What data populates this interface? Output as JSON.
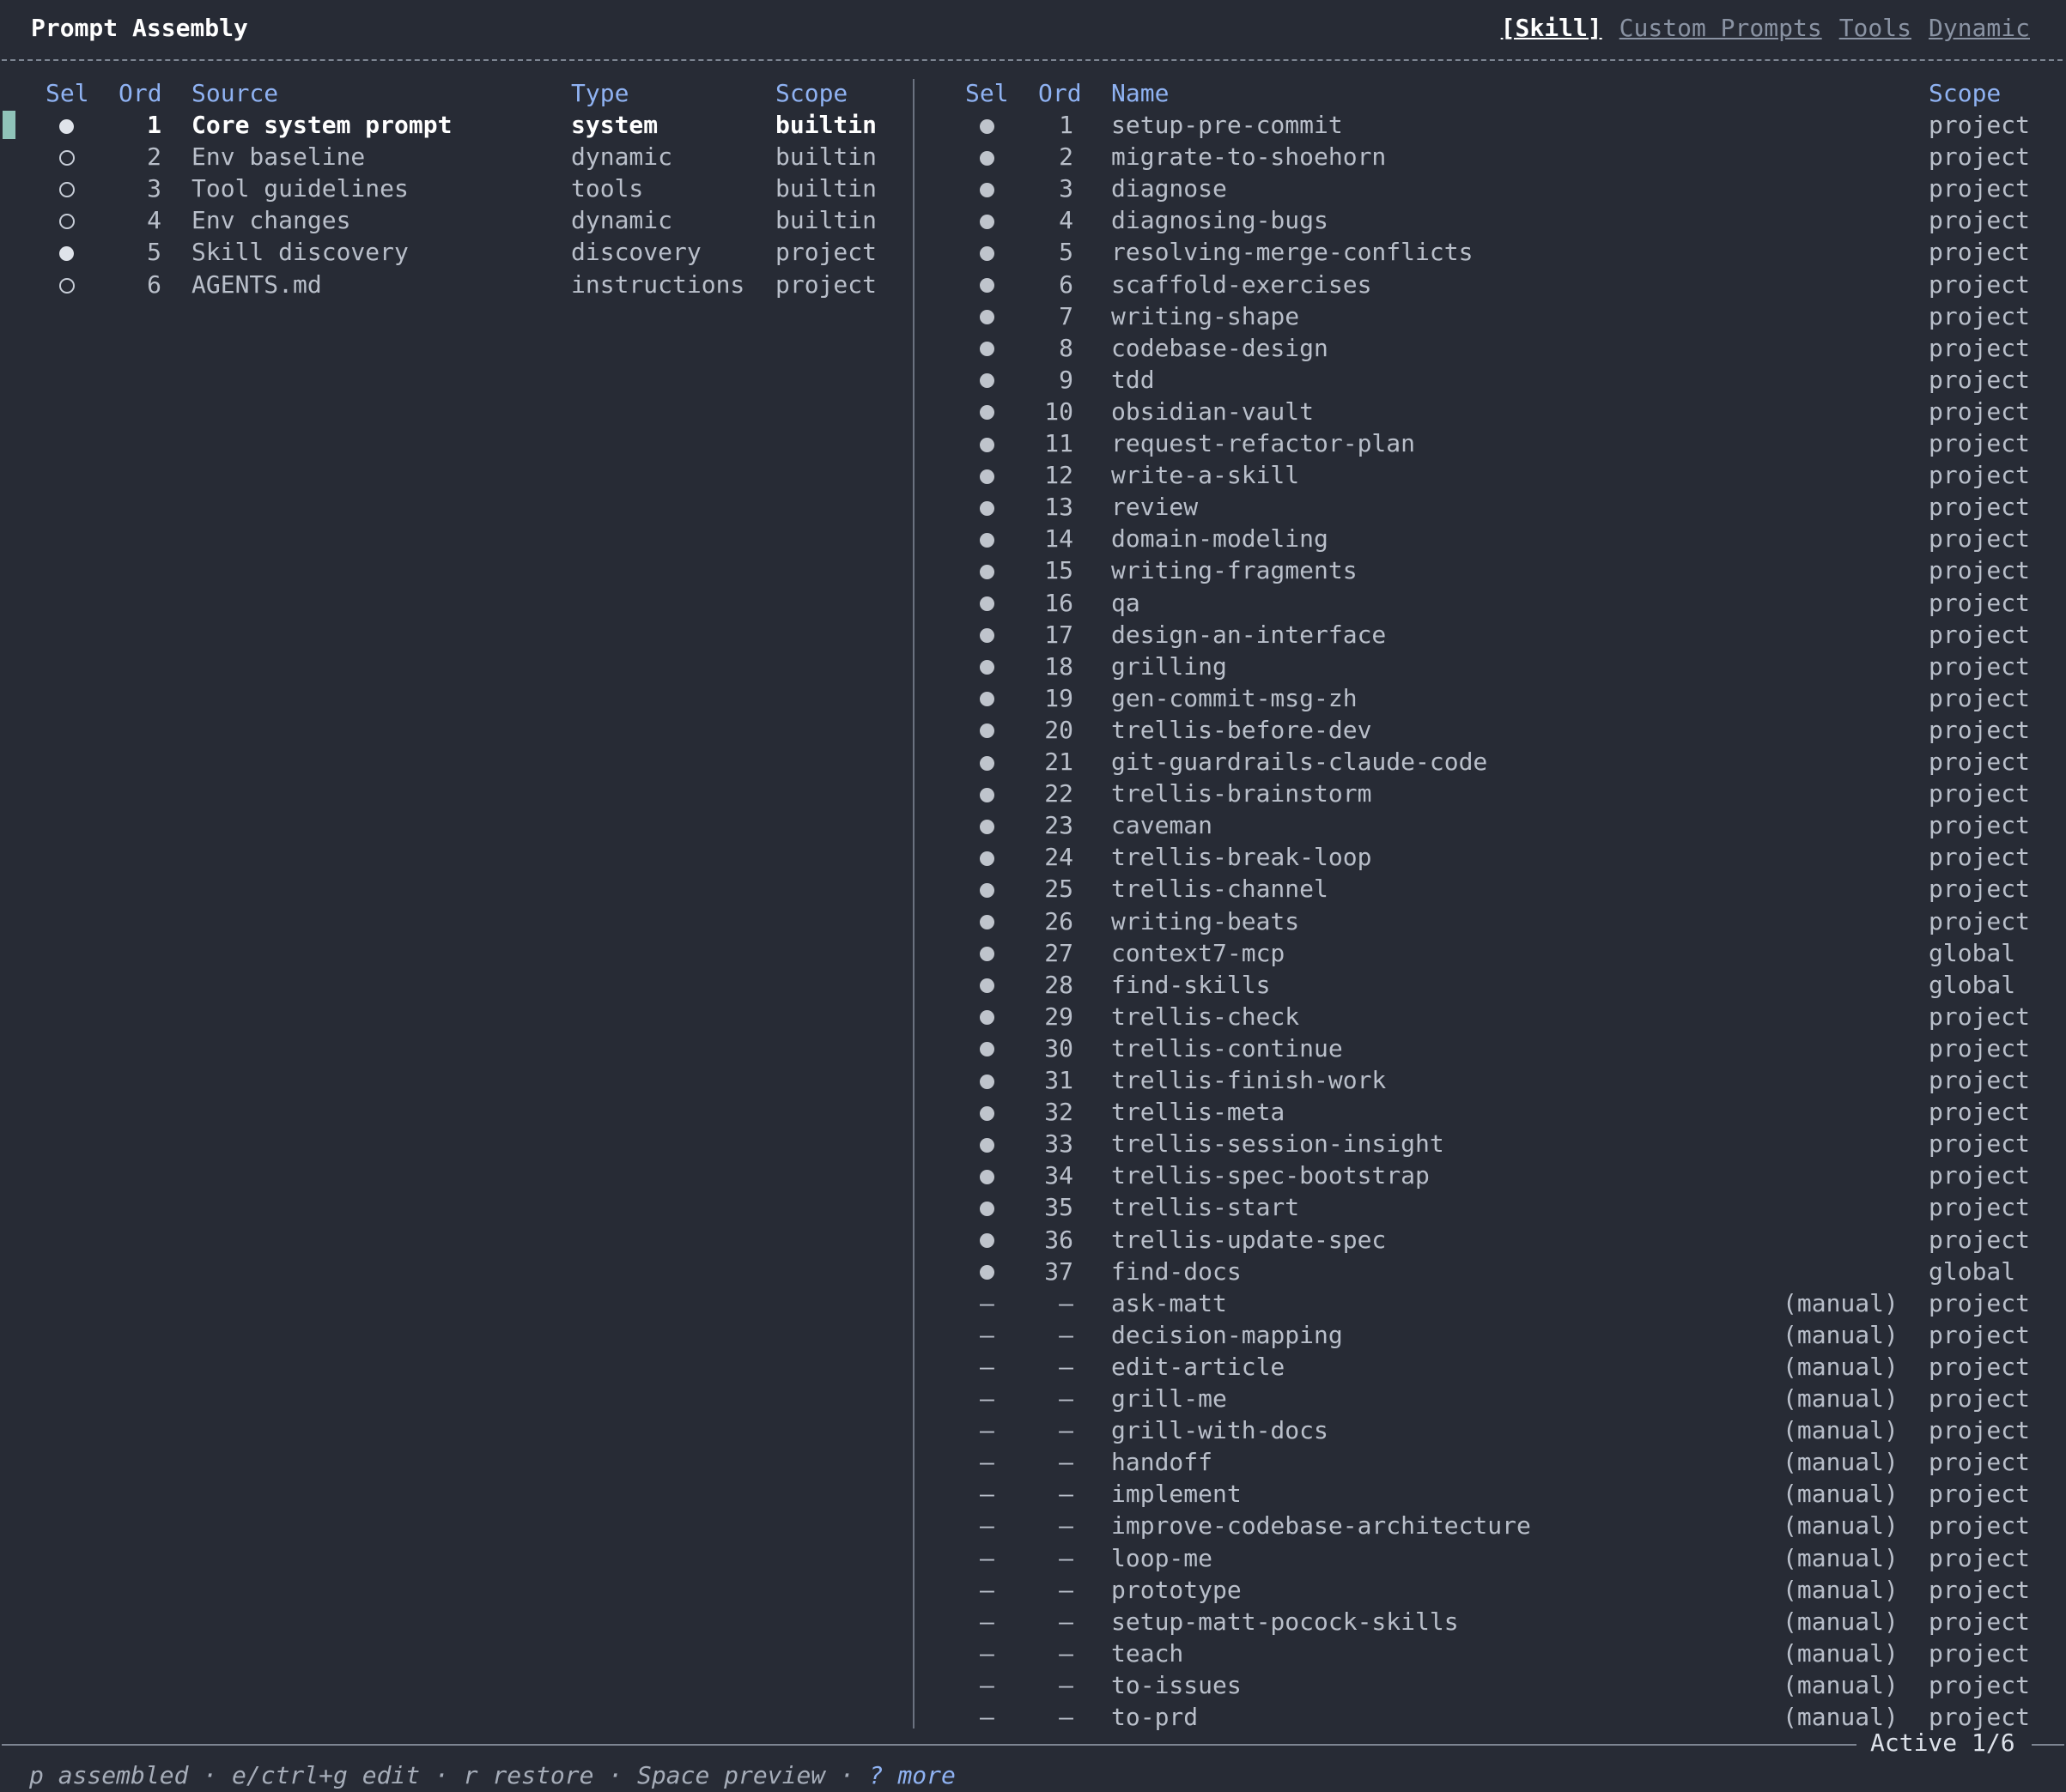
{
  "app": {
    "title": "Prompt Assembly",
    "tabs": [
      "[Skill]",
      "Custom Prompts",
      "Tools",
      "Dynamic"
    ],
    "active_tab": "[Skill]"
  },
  "left_panel": {
    "headers": {
      "sel": "Sel",
      "ord": "Ord",
      "source": "Source",
      "type": "Type",
      "scope": "Scope"
    },
    "rows": [
      {
        "sel": "filled",
        "ord": "1",
        "source": "Core system prompt",
        "type": "system",
        "scope": "builtin",
        "highlight": true
      },
      {
        "sel": "empty",
        "ord": "2",
        "source": "Env baseline",
        "type": "dynamic",
        "scope": "builtin"
      },
      {
        "sel": "empty",
        "ord": "3",
        "source": "Tool guidelines",
        "type": "tools",
        "scope": "builtin"
      },
      {
        "sel": "empty",
        "ord": "4",
        "source": "Env changes",
        "type": "dynamic",
        "scope": "builtin"
      },
      {
        "sel": "filled",
        "ord": "5",
        "source": "Skill discovery",
        "type": "discovery",
        "scope": "project"
      },
      {
        "sel": "empty",
        "ord": "6",
        "source": "AGENTS.md",
        "type": "instructions",
        "scope": "project"
      }
    ]
  },
  "right_panel": {
    "headers": {
      "sel": "Sel",
      "ord": "Ord",
      "name": "Name",
      "scope": "Scope"
    },
    "rows": [
      {
        "sel": "dot",
        "ord": "1",
        "name": "setup-pre-commit",
        "note": "",
        "scope": "project"
      },
      {
        "sel": "dot",
        "ord": "2",
        "name": "migrate-to-shoehorn",
        "note": "",
        "scope": "project"
      },
      {
        "sel": "dot",
        "ord": "3",
        "name": "diagnose",
        "note": "",
        "scope": "project"
      },
      {
        "sel": "dot",
        "ord": "4",
        "name": "diagnosing-bugs",
        "note": "",
        "scope": "project"
      },
      {
        "sel": "dot",
        "ord": "5",
        "name": "resolving-merge-conflicts",
        "note": "",
        "scope": "project"
      },
      {
        "sel": "dot",
        "ord": "6",
        "name": "scaffold-exercises",
        "note": "",
        "scope": "project"
      },
      {
        "sel": "dot",
        "ord": "7",
        "name": "writing-shape",
        "note": "",
        "scope": "project"
      },
      {
        "sel": "dot",
        "ord": "8",
        "name": "codebase-design",
        "note": "",
        "scope": "project"
      },
      {
        "sel": "dot",
        "ord": "9",
        "name": "tdd",
        "note": "",
        "scope": "project"
      },
      {
        "sel": "dot",
        "ord": "10",
        "name": "obsidian-vault",
        "note": "",
        "scope": "project"
      },
      {
        "sel": "dot",
        "ord": "11",
        "name": "request-refactor-plan",
        "note": "",
        "scope": "project"
      },
      {
        "sel": "dot",
        "ord": "12",
        "name": "write-a-skill",
        "note": "",
        "scope": "project"
      },
      {
        "sel": "dot",
        "ord": "13",
        "name": "review",
        "note": "",
        "scope": "project"
      },
      {
        "sel": "dot",
        "ord": "14",
        "name": "domain-modeling",
        "note": "",
        "scope": "project"
      },
      {
        "sel": "dot",
        "ord": "15",
        "name": "writing-fragments",
        "note": "",
        "scope": "project"
      },
      {
        "sel": "dot",
        "ord": "16",
        "name": "qa",
        "note": "",
        "scope": "project"
      },
      {
        "sel": "dot",
        "ord": "17",
        "name": "design-an-interface",
        "note": "",
        "scope": "project"
      },
      {
        "sel": "dot",
        "ord": "18",
        "name": "grilling",
        "note": "",
        "scope": "project"
      },
      {
        "sel": "dot",
        "ord": "19",
        "name": "gen-commit-msg-zh",
        "note": "",
        "scope": "project"
      },
      {
        "sel": "dot",
        "ord": "20",
        "name": "trellis-before-dev",
        "note": "",
        "scope": "project"
      },
      {
        "sel": "dot",
        "ord": "21",
        "name": "git-guardrails-claude-code",
        "note": "",
        "scope": "project"
      },
      {
        "sel": "dot",
        "ord": "22",
        "name": "trellis-brainstorm",
        "note": "",
        "scope": "project"
      },
      {
        "sel": "dot",
        "ord": "23",
        "name": "caveman",
        "note": "",
        "scope": "project"
      },
      {
        "sel": "dot",
        "ord": "24",
        "name": "trellis-break-loop",
        "note": "",
        "scope": "project"
      },
      {
        "sel": "dot",
        "ord": "25",
        "name": "trellis-channel",
        "note": "",
        "scope": "project"
      },
      {
        "sel": "dot",
        "ord": "26",
        "name": "writing-beats",
        "note": "",
        "scope": "project"
      },
      {
        "sel": "dot",
        "ord": "27",
        "name": "context7-mcp",
        "note": "",
        "scope": "global"
      },
      {
        "sel": "dot",
        "ord": "28",
        "name": "find-skills",
        "note": "",
        "scope": "global"
      },
      {
        "sel": "dot",
        "ord": "29",
        "name": "trellis-check",
        "note": "",
        "scope": "project"
      },
      {
        "sel": "dot",
        "ord": "30",
        "name": "trellis-continue",
        "note": "",
        "scope": "project"
      },
      {
        "sel": "dot",
        "ord": "31",
        "name": "trellis-finish-work",
        "note": "",
        "scope": "project"
      },
      {
        "sel": "dot",
        "ord": "32",
        "name": "trellis-meta",
        "note": "",
        "scope": "project"
      },
      {
        "sel": "dot",
        "ord": "33",
        "name": "trellis-session-insight",
        "note": "",
        "scope": "project"
      },
      {
        "sel": "dot",
        "ord": "34",
        "name": "trellis-spec-bootstrap",
        "note": "",
        "scope": "project"
      },
      {
        "sel": "dot",
        "ord": "35",
        "name": "trellis-start",
        "note": "",
        "scope": "project"
      },
      {
        "sel": "dot",
        "ord": "36",
        "name": "trellis-update-spec",
        "note": "",
        "scope": "project"
      },
      {
        "sel": "dot",
        "ord": "37",
        "name": "find-docs",
        "note": "",
        "scope": "global"
      },
      {
        "sel": "–",
        "ord": "–",
        "name": "ask-matt",
        "note": "(manual)",
        "scope": "project"
      },
      {
        "sel": "–",
        "ord": "–",
        "name": "decision-mapping",
        "note": "(manual)",
        "scope": "project"
      },
      {
        "sel": "–",
        "ord": "–",
        "name": "edit-article",
        "note": "(manual)",
        "scope": "project"
      },
      {
        "sel": "–",
        "ord": "–",
        "name": "grill-me",
        "note": "(manual)",
        "scope": "project"
      },
      {
        "sel": "–",
        "ord": "–",
        "name": "grill-with-docs",
        "note": "(manual)",
        "scope": "project"
      },
      {
        "sel": "–",
        "ord": "–",
        "name": "handoff",
        "note": "(manual)",
        "scope": "project"
      },
      {
        "sel": "–",
        "ord": "–",
        "name": "implement",
        "note": "(manual)",
        "scope": "project"
      },
      {
        "sel": "–",
        "ord": "–",
        "name": "improve-codebase-architecture",
        "note": "(manual)",
        "scope": "project"
      },
      {
        "sel": "–",
        "ord": "–",
        "name": "loop-me",
        "note": "(manual)",
        "scope": "project"
      },
      {
        "sel": "–",
        "ord": "–",
        "name": "prototype",
        "note": "(manual)",
        "scope": "project"
      },
      {
        "sel": "–",
        "ord": "–",
        "name": "setup-matt-pocock-skills",
        "note": "(manual)",
        "scope": "project"
      },
      {
        "sel": "–",
        "ord": "–",
        "name": "teach",
        "note": "(manual)",
        "scope": "project"
      },
      {
        "sel": "–",
        "ord": "–",
        "name": "to-issues",
        "note": "(manual)",
        "scope": "project"
      },
      {
        "sel": "–",
        "ord": "–",
        "name": "to-prd",
        "note": "(manual)",
        "scope": "project"
      }
    ]
  },
  "status": {
    "active_label": "Active 1/6"
  },
  "footer": {
    "keys": "p assembled · e/ctrl+g edit · r restore · Space preview · ",
    "help": "? more"
  },
  "colors": {
    "background": "#272b35",
    "header": "#8fb2f2",
    "cursor": "#8fc3b9",
    "text": "#b9bfca"
  }
}
